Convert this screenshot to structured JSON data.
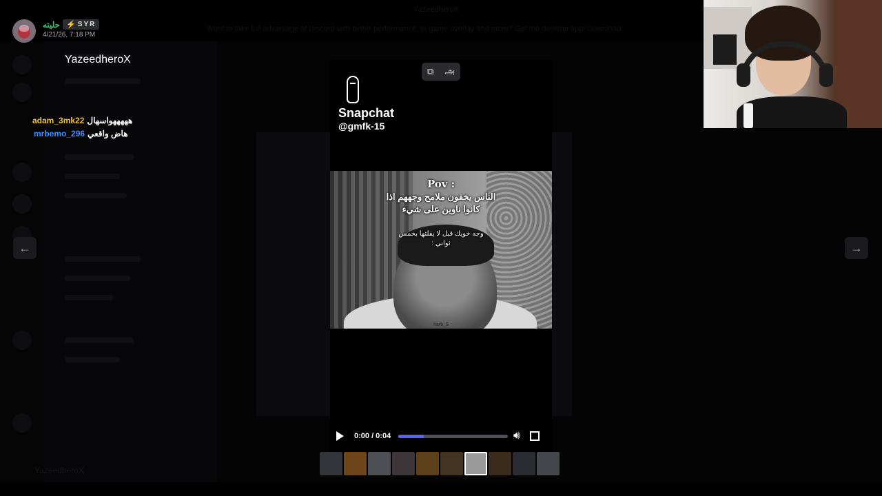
{
  "background": {
    "top_title": "YazeedheroX",
    "banner_text": "Want to take full advantage of Discord with better performance, in-game overlay and more? Get the desktop app!",
    "banner_button": "Download",
    "server_name": "YazeedheroX",
    "footer_user": "YazeedheroX"
  },
  "author": {
    "name": "حليته",
    "tag": "SYR",
    "timestamp": "4/21/26, 7:18 PM"
  },
  "live_chat": [
    {
      "user": "adam_3mk22",
      "message": "هههههواسهال"
    },
    {
      "user": "mrbemo_296",
      "message": "هاض واقعي"
    }
  ],
  "nav": {
    "prev_icon": "arrow-left-icon",
    "next_icon": "arrow-right-icon"
  },
  "media_tools": {
    "icon1": "⧉",
    "icon2": "அ"
  },
  "snapchat": {
    "title": "Snapchat",
    "handle": "@gmfk-15"
  },
  "video_overlay": {
    "pov": "Pov :",
    "line1": "الناس يخفون ملامح وجههم اذا",
    "line2": "كانوا ناوين على شيء",
    "line3": "وجه خويك قبل لا يفلتها بخمس",
    "line4": "ثواني :",
    "watermark": "harb_9"
  },
  "player": {
    "time": "0:00 / 0:04",
    "progress": 0.23
  },
  "thumbnails": [
    {
      "color": "#5a5f66",
      "active": false
    },
    {
      "color": "#c77a28",
      "active": false
    },
    {
      "color": "#8a8e95",
      "active": false
    },
    {
      "color": "#6d6266",
      "active": false
    },
    {
      "color": "#a8752c",
      "active": false
    },
    {
      "color": "#7a5a3a",
      "active": false
    },
    {
      "color": "#9b9b9b",
      "active": true
    },
    {
      "color": "#6b4a2e",
      "active": false
    },
    {
      "color": "#4a4f55",
      "active": false
    },
    {
      "color": "#7e8086",
      "active": false
    }
  ]
}
